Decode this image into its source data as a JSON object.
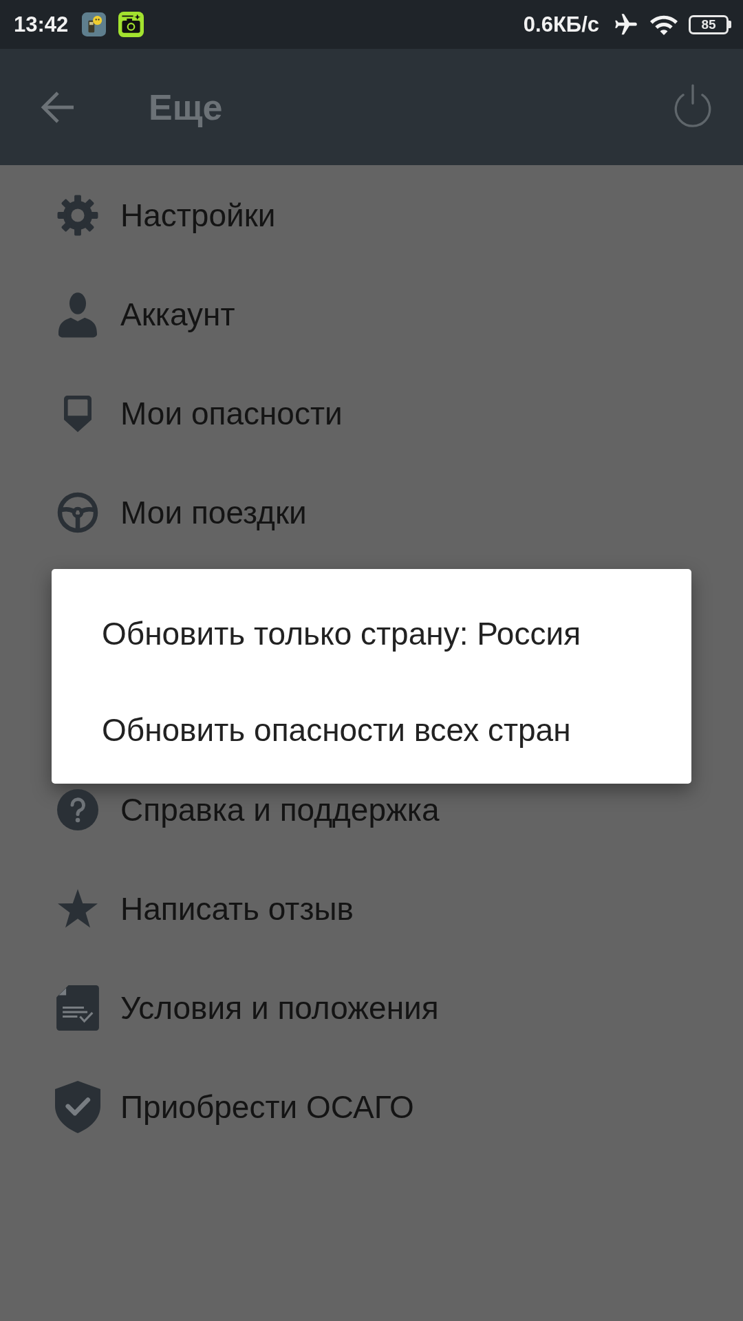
{
  "status_bar": {
    "time": "13:42",
    "network_speed": "0.6КБ/с",
    "battery": "85"
  },
  "app_bar": {
    "title": "Еще"
  },
  "menu_above_dialog": [
    {
      "kind": "settings",
      "label": "Настройки"
    },
    {
      "kind": "account",
      "label": "Аккаунт"
    },
    {
      "kind": "hazards",
      "label": "Мои опасности"
    },
    {
      "kind": "trips",
      "label": "Мои поездки"
    }
  ],
  "dialog": {
    "options": [
      "Обновить только страну: Россия",
      "Обновить опасности всех стран"
    ]
  },
  "menu_below_dialog": [
    {
      "kind": "help",
      "label": "Справка и поддержка"
    },
    {
      "kind": "review",
      "label": "Написать отзыв"
    },
    {
      "kind": "terms",
      "label": "Условия и положения"
    },
    {
      "kind": "insurance",
      "label": "Приобрести ОСАГО"
    }
  ]
}
